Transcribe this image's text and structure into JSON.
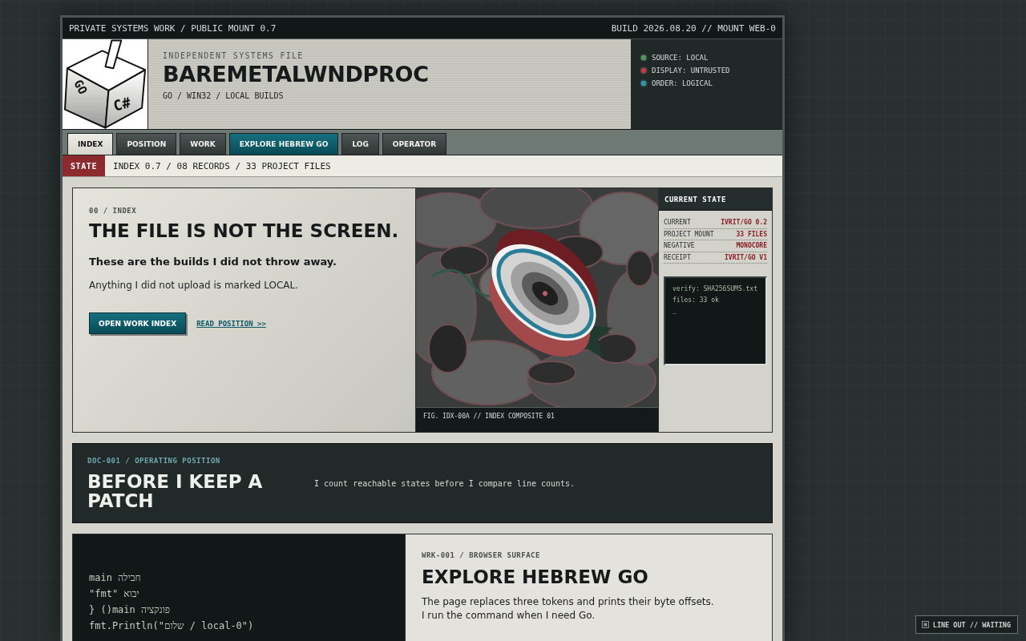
{
  "top_bar": {
    "left": "PRIVATE SYSTEMS WORK / PUBLIC MOUNT 0.7",
    "right": "BUILD 2026.08.20 // MOUNT WEB-0"
  },
  "header": {
    "logo": {
      "marks": [
        "GO",
        "C#"
      ]
    },
    "kicker": "INDEPENDENT SYSTEMS FILE",
    "title": "BAREMETALWNDPROC",
    "subtitle": "GO / WIN32 / LOCAL BUILDS",
    "status": [
      {
        "label": "SOURCE: LOCAL",
        "color": "#4f9a5a"
      },
      {
        "label": "DISPLAY: UNTRUSTED",
        "color": "#c23a40"
      },
      {
        "label": "ORDER: LOGICAL",
        "color": "#2a93b0"
      }
    ]
  },
  "tabs": [
    {
      "label": "INDEX",
      "selected": true,
      "kind": "page"
    },
    {
      "label": "POSITION",
      "selected": false,
      "kind": "page"
    },
    {
      "label": "WORK",
      "selected": false,
      "kind": "page"
    },
    {
      "label": "EXPLORE HEBREW GO",
      "selected": false,
      "kind": "feature"
    },
    {
      "label": "LOG",
      "selected": false,
      "kind": "page"
    },
    {
      "label": "OPERATOR",
      "selected": false,
      "kind": "page"
    }
  ],
  "state_bar": {
    "label": "STATE",
    "text": "INDEX 0.7 / 08 RECORDS / 33 PROJECT FILES"
  },
  "hero": {
    "kicker": "00 / INDEX",
    "title": "THE FILE IS NOT THE SCREEN.",
    "lead": "These are the builds I did not throw away.",
    "body": "Anything I did not upload is marked LOCAL.",
    "button": "OPEN WORK INDEX",
    "link": "READ POSITION >>",
    "figure": {
      "caption": "FIG. IDX-00A // INDEX COMPOSITE 01"
    }
  },
  "current_state": {
    "title": "CURRENT STATE",
    "rows": [
      {
        "label": "CURRENT",
        "value": "IVRIT/GO 0.2"
      },
      {
        "label": "PROJECT MOUNT",
        "value": "33 FILES"
      },
      {
        "label": "NEGATIVE",
        "value": "MONOCORE"
      },
      {
        "label": "RECEIPT",
        "value": "IVRIT/GO V1"
      }
    ],
    "terminal": [
      "verify: SHA256SUMS.txt",
      "files: 33 ok",
      "_"
    ]
  },
  "position": {
    "kicker": "DOC-001 / OPERATING POSITION",
    "title": "BEFORE I KEEP A PATCH",
    "text": "I count reachable states before I compare line counts."
  },
  "work": {
    "code": [
      "main חבילה",
      "\"fmt\" יבוא",
      "} ()main פונקציה",
      "fmt.Println(\"שלום / local-0\")"
    ],
    "kicker": "WRK-001 / BROWSER SURFACE",
    "title": "EXPLORE HEBREW GO",
    "body": "The page replaces three tokens and prints their byte offsets.\nI run the command when I need Go."
  },
  "line_out": {
    "text": "LINE OUT // WAITING"
  }
}
